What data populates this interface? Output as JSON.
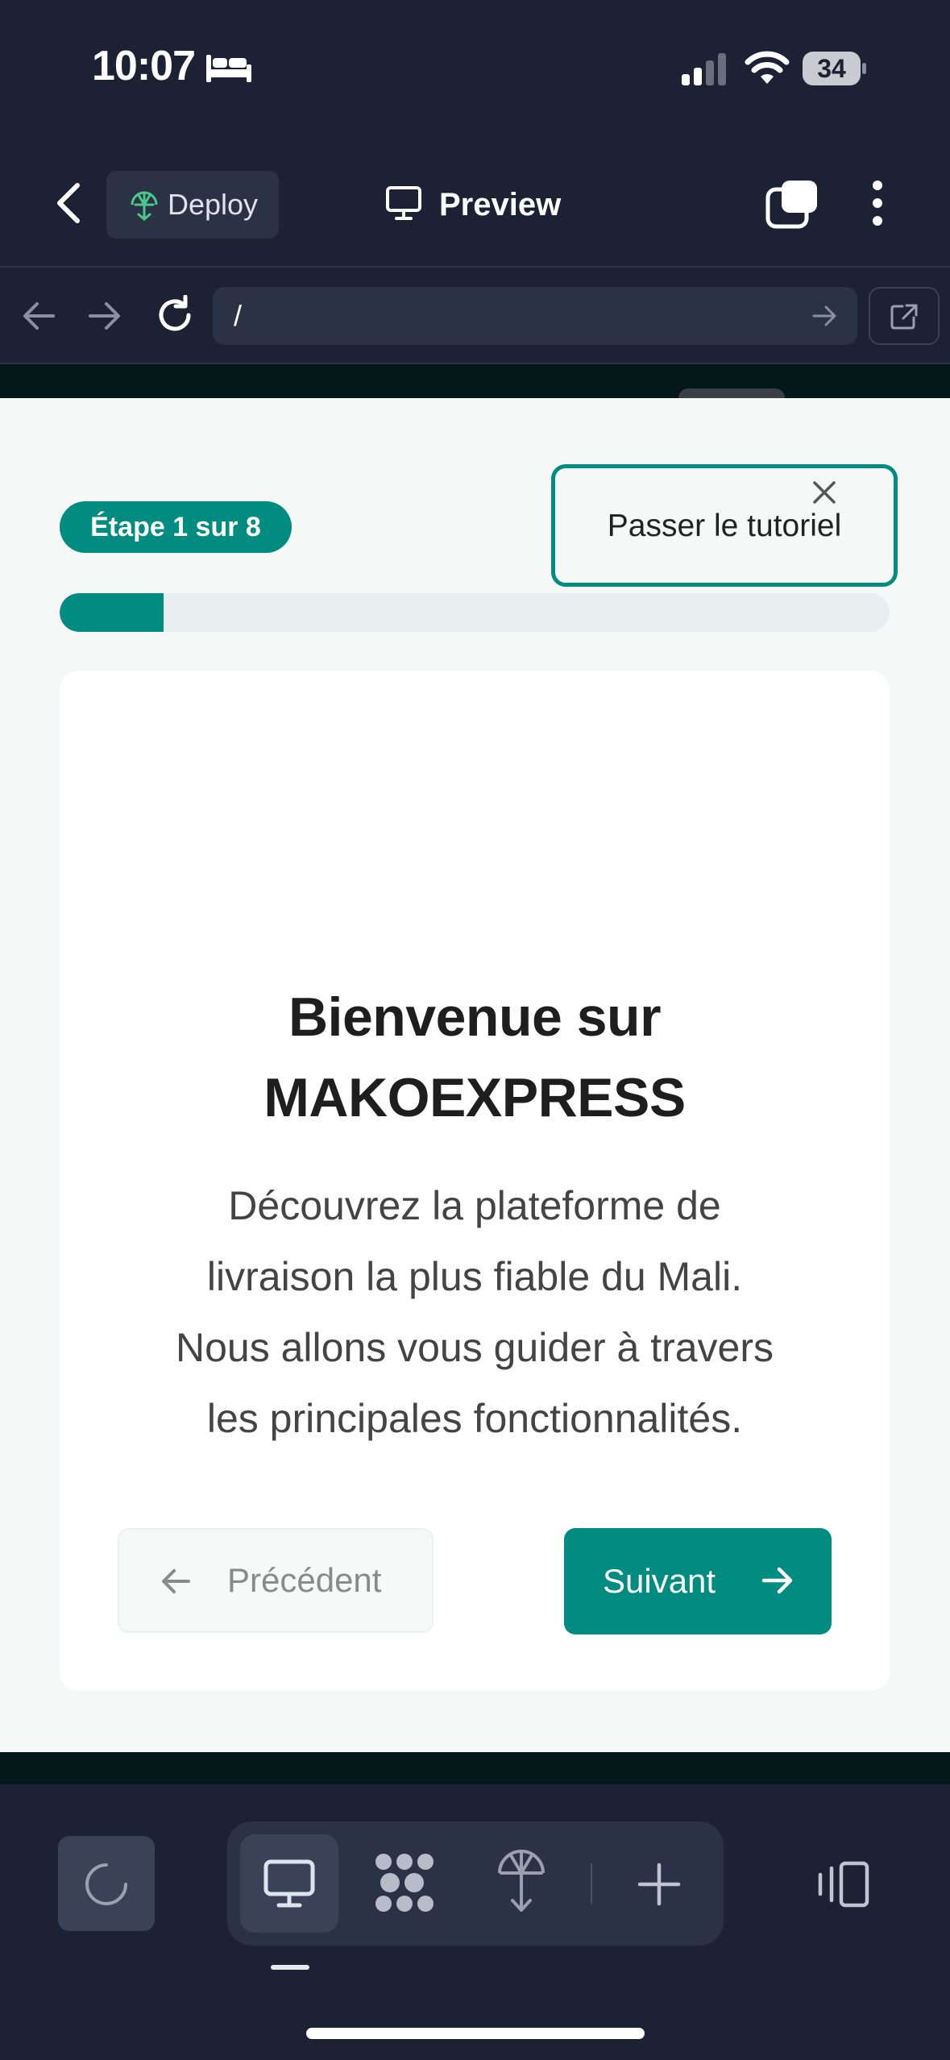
{
  "status_bar": {
    "time": "10:07",
    "battery": "34",
    "icons": [
      "bed-icon",
      "signal-icon",
      "wifi-icon",
      "battery-icon"
    ]
  },
  "header": {
    "deploy_label": "Deploy",
    "preview_label": "Preview"
  },
  "url_bar": {
    "path": "/"
  },
  "tutorial": {
    "step_label": "Étape 1 sur 8",
    "progress": 0.125,
    "skip_label": "Passer le tutoriel",
    "title_line1": "Bienvenue sur",
    "title_line2": "MAKOEXPRESS",
    "desc_lines": [
      "Découvrez la plateforme de",
      "livraison la plus fiable du Mali.",
      "Nous allons vous guider à travers",
      "les principales fonctionnalités."
    ],
    "prev_label": "Précédent",
    "next_label": "Suivant"
  },
  "colors": {
    "accent": "#008c80",
    "chrome_bg": "#1c2133",
    "chrome_surface": "#2b3246",
    "page_bg": "#f6f8f8"
  }
}
